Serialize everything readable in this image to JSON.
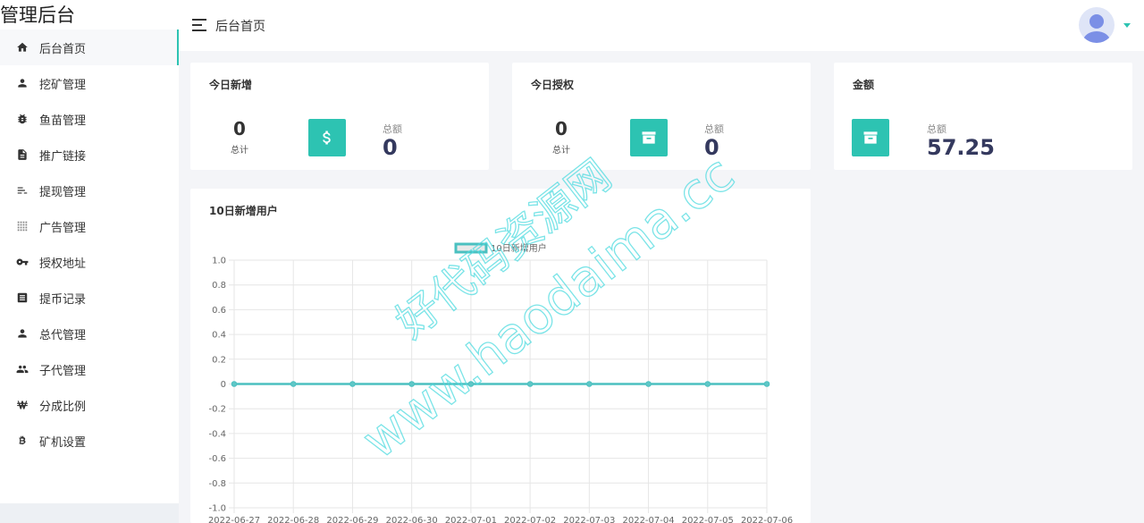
{
  "app": {
    "brand": "管理后台"
  },
  "header": {
    "title": "后台首页"
  },
  "sidebar": {
    "items": [
      {
        "label": "后台首页",
        "icon": "home-icon",
        "active": true
      },
      {
        "label": "挖矿管理",
        "icon": "person-icon"
      },
      {
        "label": "鱼苗管理",
        "icon": "bug-icon"
      },
      {
        "label": "推广链接",
        "icon": "document-icon"
      },
      {
        "label": "提现管理",
        "icon": "list-icon"
      },
      {
        "label": "广告管理",
        "icon": "grid-icon"
      },
      {
        "label": "授权地址",
        "icon": "key-icon"
      },
      {
        "label": "提币记录",
        "icon": "receipt-icon"
      },
      {
        "label": "总代管理",
        "icon": "person-icon"
      },
      {
        "label": "子代管理",
        "icon": "people-icon"
      },
      {
        "label": "分成比例",
        "icon": "won-icon"
      },
      {
        "label": "矿机设置",
        "icon": "bitcoin-icon"
      }
    ]
  },
  "cards": {
    "today_new": {
      "title": "今日新增",
      "count": "0",
      "count_label": "总计",
      "sum_label": "总额",
      "sum_value": "0",
      "icon": "dollar-icon"
    },
    "today_auth": {
      "title": "今日授权",
      "count": "0",
      "count_label": "总计",
      "sum_label": "总额",
      "sum_value": "0",
      "icon": "archive-icon"
    },
    "amount": {
      "title": "金额",
      "sum_label": "总额",
      "sum_value": "57.25",
      "icon": "archive-icon"
    }
  },
  "chart_card": {
    "title": "10日新增用户"
  },
  "chart_data": {
    "type": "line",
    "x": [
      "2022-06-27",
      "2022-06-28",
      "2022-06-29",
      "2022-06-30",
      "2022-07-01",
      "2022-07-02",
      "2022-07-03",
      "2022-07-04",
      "2022-07-05",
      "2022-07-06"
    ],
    "series": [
      {
        "name": "10日新增用户",
        "values": [
          0,
          0,
          0,
          0,
          0,
          0,
          0,
          0,
          0,
          0
        ],
        "color": "#4bc0c0"
      }
    ],
    "ylim": [
      -1.0,
      1.0
    ],
    "yticks": [
      "1.0",
      "0.8",
      "0.6",
      "0.4",
      "0.2",
      "0",
      "-0.2",
      "-0.4",
      "-0.6",
      "-0.8",
      "-1.0"
    ],
    "grid": true,
    "legend": "top"
  },
  "watermark": {
    "line1": "好代码资源网",
    "line2": "www.haodaima.cc"
  },
  "colors": {
    "accent": "#2dc3b2",
    "line": "#4bc0c0",
    "sum_value": "#34395e"
  }
}
